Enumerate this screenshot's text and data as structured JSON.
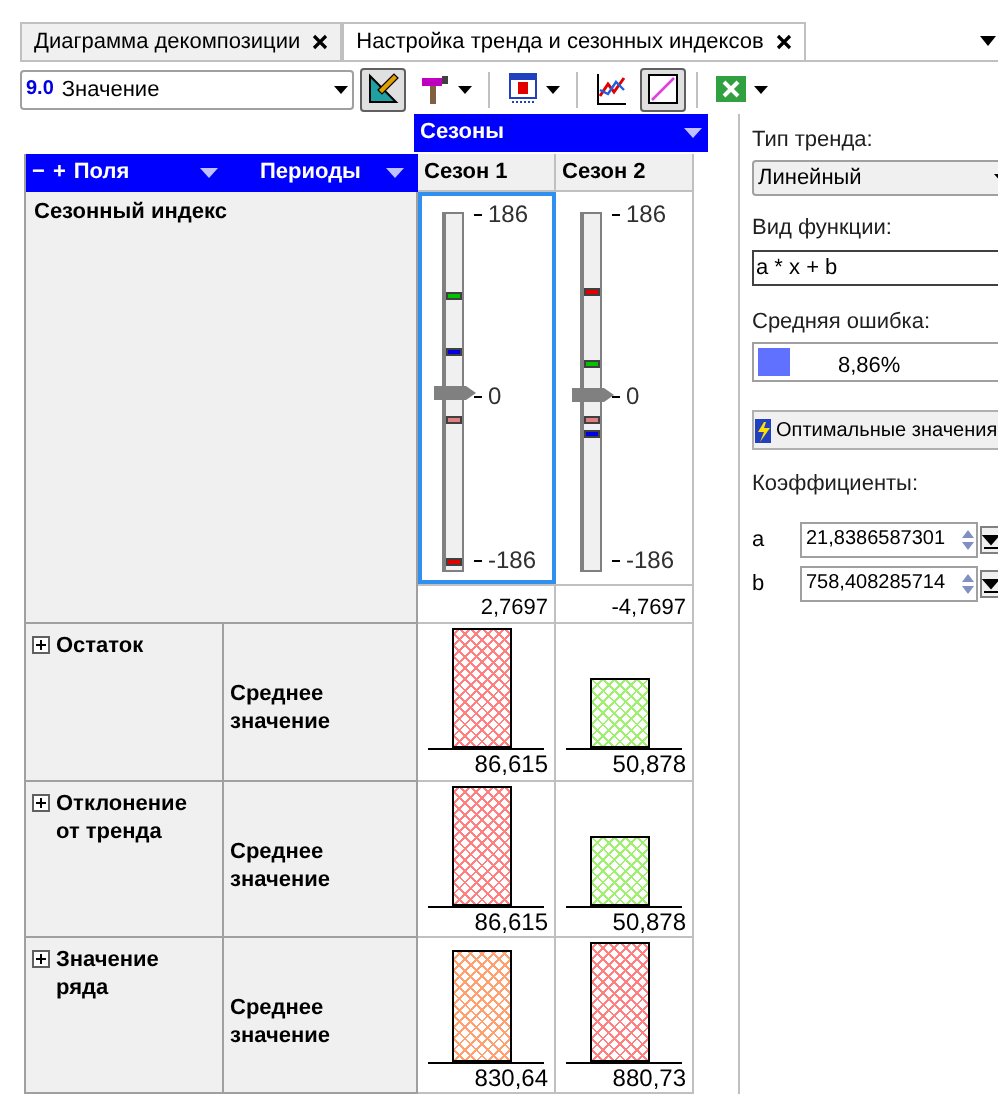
{
  "tabs": [
    {
      "label": "Диаграмма декомпозиции",
      "selected": false
    },
    {
      "label": "Настройка тренда и сезонных индексов",
      "selected": true
    }
  ],
  "toolbar": {
    "combo": {
      "badge": "9.0",
      "value": "Значение"
    },
    "buttons": [
      {
        "kind": "ruler",
        "pressed": true,
        "dropdown": false
      },
      {
        "kind": "hammer",
        "pressed": false,
        "dropdown": true
      },
      {
        "kind": "calendar",
        "pressed": false,
        "dropdown": true
      },
      {
        "kind": "linechart",
        "pressed": false,
        "dropdown": false
      },
      {
        "kind": "diagonal",
        "pressed": true,
        "dropdown": false
      },
      {
        "kind": "sheet",
        "pressed": false,
        "dropdown": true
      }
    ]
  },
  "column_dimension": "Сезоны",
  "row_header": {
    "fields": "Поля",
    "periods": "Периоды",
    "collapse": "−",
    "expand": "+"
  },
  "columns": [
    "Сезон 1",
    "Сезон 2"
  ],
  "seasonal_index": {
    "label": "Сезонный индекс",
    "gauges": [
      {
        "selected": true,
        "max": "186",
        "zero": "0",
        "min": "-186",
        "thumb": {
          "level": 0.5
        },
        "value": "2,7697",
        "marks": [
          {
            "color": "#00c000",
            "level": 0.77
          },
          {
            "color": "#0000e0",
            "level": 0.61
          },
          {
            "color": "#e08080",
            "level": 0.42
          },
          {
            "color": "#e00000",
            "level": 0.02
          }
        ]
      },
      {
        "selected": false,
        "max": "186",
        "zero": "0",
        "min": "-186",
        "thumb": {
          "level": 0.49
        },
        "value": "-4,7697",
        "marks": [
          {
            "color": "#e00000",
            "level": 0.78
          },
          {
            "color": "#00c000",
            "level": 0.58
          },
          {
            "color": "#e08080",
            "level": 0.42
          },
          {
            "color": "#0000e0",
            "level": 0.38
          }
        ]
      }
    ]
  },
  "rows": [
    {
      "label": "Остаток",
      "measure": "Среднее значение",
      "cells": [
        {
          "value": "86,615",
          "level": 1,
          "color": "#ff8080"
        },
        {
          "value": "50,878",
          "level": 0.59,
          "color": "#a0f070"
        }
      ]
    },
    {
      "label": "Отклонение от тренда",
      "measure": "Среднее значение",
      "cells": [
        {
          "value": "86,615",
          "level": 1,
          "color": "#ff8080"
        },
        {
          "value": "50,878",
          "level": 0.59,
          "color": "#a0f070"
        }
      ]
    },
    {
      "label": "Значение ряда",
      "measure": "Среднее значение",
      "cells": [
        {
          "value": "830,64",
          "level": 0.94,
          "color": "#ffa070"
        },
        {
          "value": "880,73",
          "level": 1,
          "color": "#ff8080"
        }
      ]
    }
  ],
  "panel": {
    "trend_type_label": "Тип тренда:",
    "trend_type": "Линейный",
    "function_label": "Вид функции:",
    "function": "a * x + b",
    "error_label": "Средняя ошибка:",
    "error": {
      "level": 0.12,
      "text": "8,86%"
    },
    "optimal_button": "Оптимальные значения",
    "coefficients_label": "Коэффициенты:",
    "coefficients": [
      {
        "name": "a",
        "value": "21,8386587301"
      },
      {
        "name": "b",
        "value": "758,408285714"
      }
    ]
  }
}
